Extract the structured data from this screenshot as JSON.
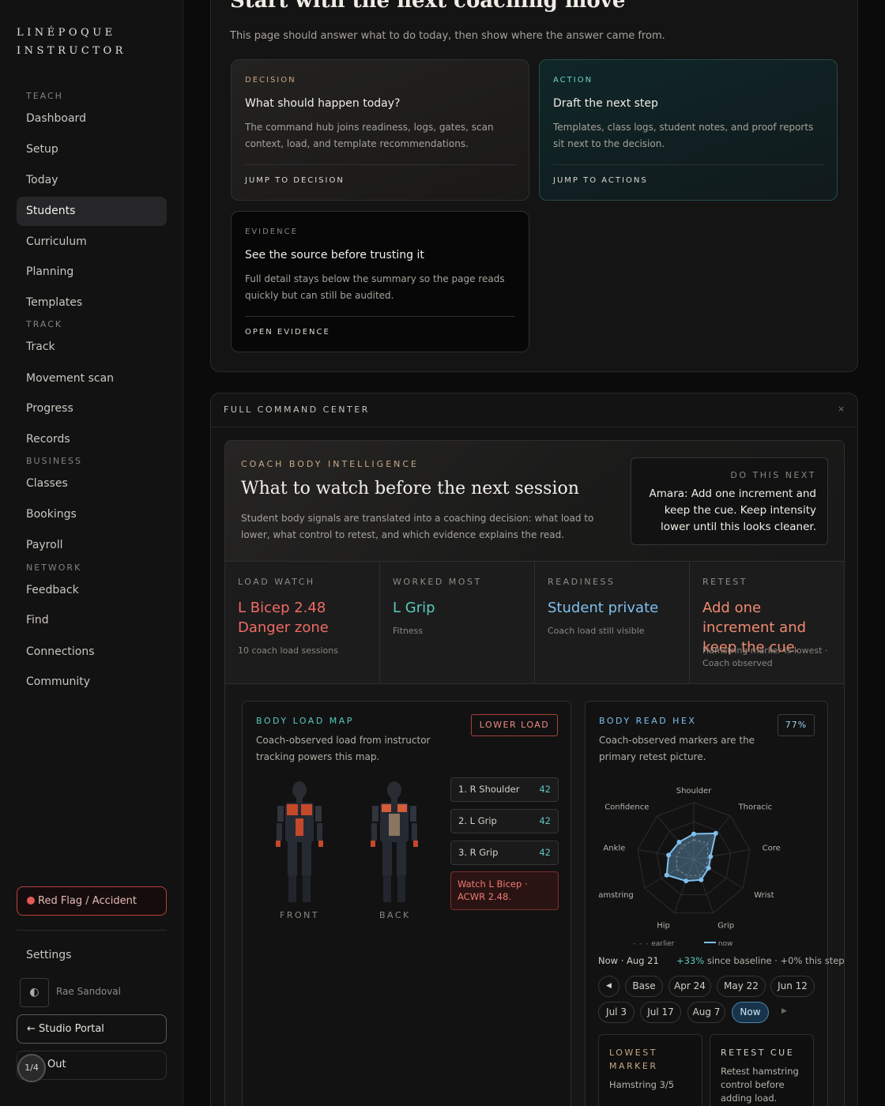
{
  "brand": {
    "line1": "LINÉPOQUE",
    "line2": "INSTRUCTOR"
  },
  "sidebar": {
    "sections": {
      "teach": "TEACH",
      "track": "TRACK",
      "business": "BUSINESS",
      "network": "NETWORK"
    },
    "items": {
      "dashboard": "Dashboard",
      "setup": "Setup",
      "today": "Today",
      "students": "Students",
      "curriculum": "Curriculum",
      "planning": "Planning",
      "templates": "Templates",
      "track": "Track",
      "movement_scan": "Movement scan",
      "progress": "Progress",
      "records": "Records",
      "classes": "Classes",
      "bookings": "Bookings",
      "payroll": "Payroll",
      "feedback": "Feedback",
      "find": "Find",
      "connections": "Connections",
      "community": "Community"
    },
    "active": "students",
    "red_flag": "Red Flag / Accident",
    "settings": "Settings",
    "user_name": "Rae Sandoval",
    "studio_portal": "← Studio Portal",
    "out": "Out",
    "pager": "1/4"
  },
  "hero": {
    "title": "Start with the next coaching move",
    "subtitle": "This page should answer what to do today, then show where the answer came from."
  },
  "cards": {
    "decision": {
      "kicker": "DECISION",
      "title": "What should happen today?",
      "desc": "The command hub joins readiness, logs, gates, scan context, load, and template recommendations.",
      "link": "JUMP TO DECISION"
    },
    "action": {
      "kicker": "ACTION",
      "title": "Draft the next step",
      "desc": "Templates, class logs, student notes, and proof reports sit next to the decision.",
      "link": "JUMP TO ACTIONS"
    },
    "evidence": {
      "kicker": "EVIDENCE",
      "title": "See the source before trusting it",
      "desc": "Full detail stays below the summary so the page reads quickly but can still be audited.",
      "link": "OPEN EVIDENCE"
    }
  },
  "command": {
    "title": "FULL COMMAND CENTER",
    "close": "×",
    "intel": {
      "kicker": "COACH BODY INTELLIGENCE",
      "title": "What to watch before the next session",
      "desc": "Student body signals are translated into a coaching decision: what load to lower, what control to retest, and which evidence explains the read.",
      "next_kicker": "DO THIS NEXT",
      "next_text": "Amara: Add one increment and keep the cue. Keep intensity lower until this looks cleaner."
    },
    "metrics": {
      "load": {
        "label": "LOAD WATCH",
        "value": "L Bicep 2.48 Danger zone",
        "sub": "10 coach load sessions"
      },
      "worked": {
        "label": "WORKED MOST",
        "value": "L Grip",
        "sub": "Fitness"
      },
      "readiness": {
        "label": "READINESS",
        "value": "Student private",
        "sub": "Coach load still visible"
      },
      "retest": {
        "label": "RETEST",
        "value": "Add one increment and keep the cue.",
        "sub": "Hamstring marker is lowest · Coach observed"
      }
    },
    "load_map": {
      "title": "BODY LOAD MAP",
      "desc": "Coach-observed load from instructor tracking powers this map.",
      "button": "LOWER LOAD",
      "ranks": [
        {
          "label": "1. R Shoulder",
          "value": "42"
        },
        {
          "label": "2. L Grip",
          "value": "42"
        },
        {
          "label": "3. R Grip",
          "value": "42"
        }
      ],
      "watch": "Watch L Bicep · ACWR 2.48.",
      "front": "FRONT",
      "back": "BACK"
    },
    "hex": {
      "title": "BODY READ HEX",
      "percent": "77%",
      "desc": "Coach-observed markers are the primary retest picture.",
      "axes": [
        "Shoulder",
        "Thoracic",
        "Core",
        "Wrist",
        "Grip",
        "Hip",
        "Hamstring",
        "Ankle",
        "Confidence"
      ],
      "now": [
        0.45,
        0.6,
        0.3,
        0.3,
        0.38,
        0.4,
        0.55,
        0.45,
        0.4
      ],
      "earlier": [
        0.35,
        0.38,
        0.25,
        0.25,
        0.3,
        0.3,
        0.35,
        0.3,
        0.3
      ],
      "legend_earlier": "earlier",
      "legend_now": "now",
      "date": "Now · Aug 21",
      "delta_strong": "+33%",
      "delta_rest": " since baseline · +0% this step",
      "timeline_row1": [
        "Base",
        "Apr 24",
        "May 22",
        "Jun 12"
      ],
      "timeline_row2": [
        "Jul 3",
        "Jul 17",
        "Aug 7",
        "Now"
      ],
      "prev": "◀",
      "next": "▶",
      "lowest": {
        "label": "LOWEST MARKER",
        "value": "Hamstring 3/5"
      },
      "retest_cue": {
        "label": "RETEST CUE",
        "value": "Retest hamstring control before adding load."
      }
    },
    "colors": {
      "danger": "#ef6b63",
      "teal": "#59c9be",
      "blue": "#7ec0ee",
      "salmon": "#f08a72",
      "accent": "#c9a884"
    }
  }
}
